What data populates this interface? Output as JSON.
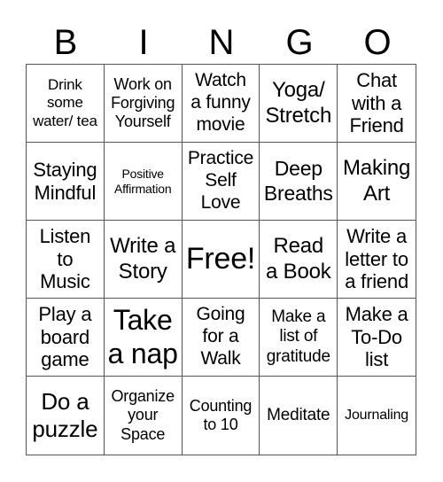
{
  "header": [
    "B",
    "I",
    "N",
    "G",
    "O"
  ],
  "cells": [
    {
      "text": "Drink\nsome\nwater/ tea",
      "size": 17
    },
    {
      "text": "Work on\nForgiving\nYourself",
      "size": 18
    },
    {
      "text": "Watch\na funny\nmovie",
      "size": 21
    },
    {
      "text": "Yoga/\nStretch",
      "size": 24
    },
    {
      "text": "Chat\nwith a\nFriend",
      "size": 22
    },
    {
      "text": "Staying\nMindful",
      "size": 22
    },
    {
      "text": "Positive\nAffirmation",
      "size": 14
    },
    {
      "text": "Practice\nSelf\nLove",
      "size": 21
    },
    {
      "text": "Deep\nBreaths",
      "size": 23
    },
    {
      "text": "Making\nArt",
      "size": 24
    },
    {
      "text": "Listen\nto\nMusic",
      "size": 22
    },
    {
      "text": "Write a\nStory",
      "size": 24
    },
    {
      "text": "Free!",
      "size": 34
    },
    {
      "text": "Read\na Book",
      "size": 24
    },
    {
      "text": "Write a\nletter to\na friend",
      "size": 22
    },
    {
      "text": "Play a\nboard\ngame",
      "size": 22
    },
    {
      "text": "Take\na nap",
      "size": 32
    },
    {
      "text": "Going\nfor a\nWalk",
      "size": 21
    },
    {
      "text": "Make a\nlist of\ngratitude",
      "size": 19
    },
    {
      "text": "Make a\nTo-Do\nlist",
      "size": 22
    },
    {
      "text": "Do a\npuzzle",
      "size": 26
    },
    {
      "text": "Organize\nyour\nSpace",
      "size": 18
    },
    {
      "text": "Counting\nto 10",
      "size": 18
    },
    {
      "text": "Meditate",
      "size": 19
    },
    {
      "text": "Journaling",
      "size": 16
    }
  ]
}
